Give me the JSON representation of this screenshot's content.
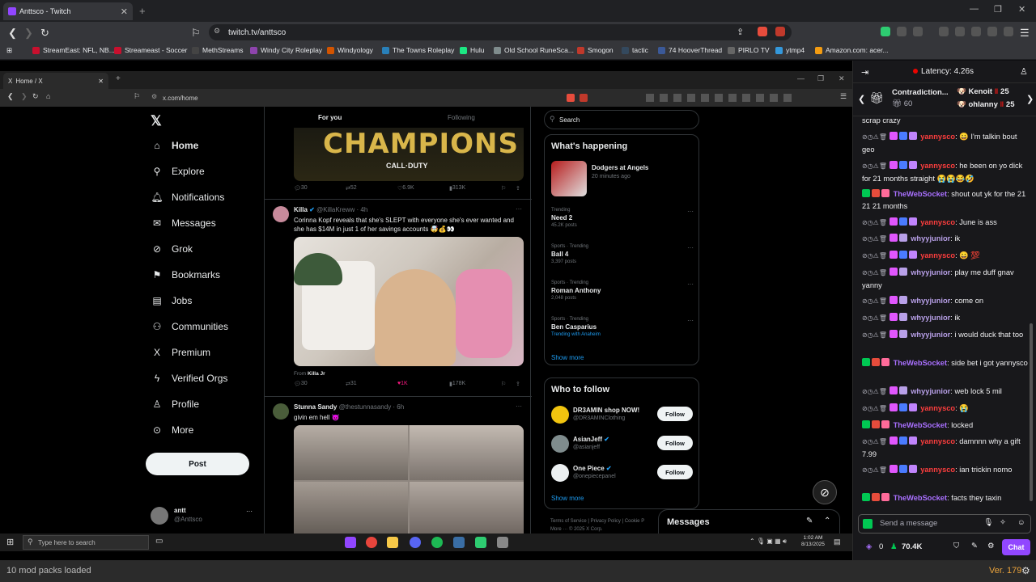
{
  "outer_browser": {
    "tab_title": "Anttsco - Twitch",
    "url": "twitch.tv/anttsco",
    "bookmarks": [
      {
        "label": "StreamEast: NFL, NB...",
        "color": "#c8102e"
      },
      {
        "label": "Streameast - Soccer",
        "color": "#c8102e"
      },
      {
        "label": "MethStreams",
        "color": "#222222"
      },
      {
        "label": "Windy City Roleplay",
        "color": "#8e44ad"
      },
      {
        "label": "Windyology",
        "color": "#d35400"
      },
      {
        "label": "The Towns Roleplay",
        "color": "#2980b9"
      },
      {
        "label": "Hulu",
        "color": "#1ce783"
      },
      {
        "label": "Old School RuneSca...",
        "color": "#7f8c8d"
      },
      {
        "label": "Smogon",
        "color": "#c0392b"
      },
      {
        "label": "tactic",
        "color": "#34495e"
      },
      {
        "label": "74 HooverThread",
        "color": "#2c3e50"
      },
      {
        "label": "PIRLO TV",
        "color": "#555555"
      },
      {
        "label": "ytmp4",
        "color": "#3498db"
      },
      {
        "label": "Amazon.com: acer...",
        "color": "#f39c12"
      }
    ]
  },
  "inner_browser": {
    "tab_title": "Home / X",
    "url": "x.com/home"
  },
  "x": {
    "nav": [
      {
        "label": "Home",
        "icon": "home-icon",
        "glyph": "⌂"
      },
      {
        "label": "Explore",
        "icon": "search-icon",
        "glyph": "⚲"
      },
      {
        "label": "Notifications",
        "icon": "bell-icon",
        "glyph": "♫"
      },
      {
        "label": "Messages",
        "icon": "envelope-icon",
        "glyph": "✉"
      },
      {
        "label": "Grok",
        "icon": "grok-icon",
        "glyph": "⊘"
      },
      {
        "label": "Bookmarks",
        "icon": "bookmark-icon",
        "glyph": "⚑"
      },
      {
        "label": "Jobs",
        "icon": "briefcase-icon",
        "glyph": "▤"
      },
      {
        "label": "Communities",
        "icon": "people-icon",
        "glyph": "⚇"
      },
      {
        "label": "Premium",
        "icon": "x-icon",
        "glyph": "X"
      },
      {
        "label": "Verified Orgs",
        "icon": "lightning-icon",
        "glyph": "ϟ"
      },
      {
        "label": "Profile",
        "icon": "person-icon",
        "glyph": "♙"
      },
      {
        "label": "More",
        "icon": "more-circle-icon",
        "glyph": "⊙"
      }
    ],
    "post_label": "Post",
    "account": {
      "name": "antt",
      "handle": "@Anttsco"
    },
    "tabs": {
      "for_you": "For you",
      "following": "Following"
    },
    "champ_banner": {
      "title": "CHAMPIONS",
      "subtitle": "CALL·DUTY"
    },
    "tweet0_stats": {
      "replies": "30",
      "reposts": "52",
      "likes": "6.9K",
      "views": "313K"
    },
    "tweet1": {
      "name": "Killa",
      "handle": "@KillaKreww · 4h",
      "text": "Corinna Kopf reveals that she's SLEPT with everyone she's ever wanted and she has $14M in just 1 of her savings accounts 🤯💰👀",
      "from_prefix": "From",
      "from_name": "Killa Jr",
      "stats": {
        "replies": "30",
        "reposts": "31",
        "likes": "1K",
        "views": "178K"
      }
    },
    "tweet2": {
      "name": "Stunna Sandy",
      "handle": "@thestunnasandy · 6h",
      "text": "givin em hell 😈"
    },
    "search_placeholder": "Search",
    "whats_happening": {
      "title": "What's happening",
      "event": {
        "title": "Dodgers at Angels",
        "time": "20 minutes ago"
      },
      "trends": [
        {
          "context": "Trending",
          "name": "Need 2",
          "posts": "45.2K posts"
        },
        {
          "context": "Sports · Trending",
          "name": "Ball 4",
          "posts": "3,397 posts"
        },
        {
          "context": "Sports · Trending",
          "name": "Roman Anthony",
          "posts": "2,048 posts"
        },
        {
          "context": "Sports · Trending",
          "name": "Ben Casparius",
          "posts": "Trending with Anaheim"
        }
      ],
      "show_more": "Show more"
    },
    "who_to_follow": {
      "title": "Who to follow",
      "accounts": [
        {
          "name": "DR3AMIN shop NOW!",
          "handle": "@DR3AMINClothing",
          "color": "#f1c40f"
        },
        {
          "name": "AsianJeff",
          "handle": "@asianjeff",
          "color": "#7f8c8d"
        },
        {
          "name": "One Piece",
          "handle": "@onepiecepanel",
          "color": "#ecf0f1"
        }
      ],
      "follow_label": "Follow",
      "show_more": "Show more"
    },
    "footer": {
      "terms": "Terms of Service",
      "privacy": "Privacy Policy",
      "cookie": "Cookie P",
      "more": "More ··· © 2025 X Corp."
    },
    "messages_label": "Messages"
  },
  "taskbar": {
    "search_placeholder": "Type here to search",
    "time": "1:02 AM",
    "date": "8/13/2025"
  },
  "status": {
    "mods": "10 mod packs loaded",
    "version": "Ver. 179"
  },
  "chat": {
    "latency": "Latency: 4.26s",
    "banner": {
      "name": "Contradiction...",
      "count": "60",
      "user1": "Kenoit",
      "user1_count": "25",
      "user2": "ohlanny",
      "user2_count": "25"
    },
    "top_text": "scrap crazy",
    "messages": [
      {
        "user": "yannysco",
        "color": "#ff3e3e",
        "text": ": 😀 I'm talkin bout geo"
      },
      {
        "user": "yannysco",
        "color": "#ff3e3e",
        "text": ": he been on yo dick for 21 months straight 😭😭😂🤣"
      },
      {
        "user": "TheWebSocket",
        "color": "#a970ff",
        "text": ": shout out yk for the 21 21 21 months"
      },
      {
        "user": "yannysco",
        "color": "#ff3e3e",
        "text": ": June is ass"
      },
      {
        "user": "whyyjunior",
        "color": "#b8a0e8",
        "text": ": ik"
      },
      {
        "user": "yannysco",
        "color": "#ff3e3e",
        "text": ": 😀 💯"
      },
      {
        "user": "whyyjunior",
        "color": "#b8a0e8",
        "text": ": play me duff gnav yanny"
      },
      {
        "user": "whyyjunior",
        "color": "#b8a0e8",
        "text": ": come on"
      },
      {
        "user": "whyyjunior",
        "color": "#b8a0e8",
        "text": ": ik"
      },
      {
        "user": "whyyjunior",
        "color": "#b8a0e8",
        "text": ": i would duck that too"
      },
      {
        "user": "TheWebSocket",
        "color": "#a970ff",
        "text": ": side bet i got yannysco"
      },
      {
        "user": "whyyjunior",
        "color": "#b8a0e8",
        "text": ": web lock 5 mil"
      },
      {
        "user": "yannysco",
        "color": "#ff3e3e",
        "text": ": 😭"
      },
      {
        "user": "TheWebSocket",
        "color": "#a970ff",
        "text": ": locked"
      },
      {
        "user": "yannysco",
        "color": "#ff3e3e",
        "text": ": damnnn why a gift 7.99"
      },
      {
        "user": "yannysco",
        "color": "#ff3e3e",
        "text": ": ian trickin nomo"
      },
      {
        "user": "TheWebSocket",
        "color": "#a970ff",
        "text": ": facts they taxin"
      }
    ],
    "input_placeholder": "Send a message",
    "points": "0",
    "viewers": "70.4K",
    "chat_button": "Chat"
  }
}
